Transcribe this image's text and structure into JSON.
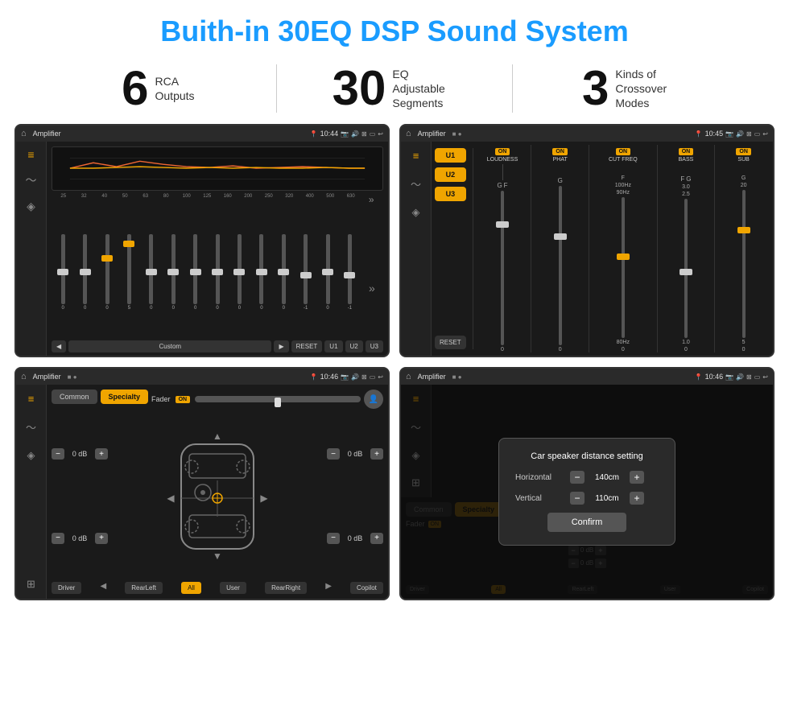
{
  "page": {
    "title": "Buith-in 30EQ DSP Sound System"
  },
  "stats": [
    {
      "number": "6",
      "label": "RCA\nOutputs"
    },
    {
      "number": "30",
      "label": "EQ Adjustable\nSegments"
    },
    {
      "number": "3",
      "label": "Kinds of\nCrossover Modes"
    }
  ],
  "screen1": {
    "status_title": "Amplifier",
    "time": "10:44",
    "eq_freqs": [
      "25",
      "32",
      "40",
      "50",
      "63",
      "80",
      "100",
      "125",
      "160",
      "200",
      "250",
      "320",
      "400",
      "500",
      "630"
    ],
    "eq_values": [
      "0",
      "0",
      "0",
      "5",
      "0",
      "0",
      "0",
      "0",
      "0",
      "0",
      "0",
      "0",
      "-1",
      "0",
      "-1"
    ],
    "eq_preset": "Custom",
    "buttons": [
      "RESET",
      "U1",
      "U2",
      "U3"
    ]
  },
  "screen2": {
    "status_title": "Amplifier",
    "time": "10:45",
    "u_buttons": [
      "U1",
      "U2",
      "U3"
    ],
    "controls": [
      {
        "label": "LOUDNESS",
        "on": true
      },
      {
        "label": "PHAT",
        "on": true
      },
      {
        "label": "CUT FREQ",
        "on": true
      },
      {
        "label": "BASS",
        "on": true
      },
      {
        "label": "SUB",
        "on": true
      }
    ],
    "reset_label": "RESET"
  },
  "screen3": {
    "status_title": "Amplifier",
    "time": "10:46",
    "tabs": [
      "Common",
      "Specialty"
    ],
    "active_tab": "Specialty",
    "fader_label": "Fader",
    "fader_on": "ON",
    "db_values": [
      "0 dB",
      "0 dB",
      "0 dB",
      "0 dB"
    ],
    "buttons": [
      "Driver",
      "RearLeft",
      "All",
      "User",
      "RearRight",
      "Copilot"
    ]
  },
  "screen4": {
    "status_title": "Amplifier",
    "time": "10:46",
    "tabs": [
      "Common",
      "Specialty"
    ],
    "dialog": {
      "title": "Car speaker distance setting",
      "horizontal_label": "Horizontal",
      "horizontal_value": "140cm",
      "vertical_label": "Vertical",
      "vertical_value": "110cm",
      "confirm_label": "Confirm"
    },
    "db_values": [
      "0 dB",
      "0 dB"
    ],
    "buttons": [
      "Driver",
      "RearLeft",
      "All",
      "User",
      "RearRight",
      "Copilot"
    ]
  },
  "colors": {
    "accent": "#f0a500",
    "title_blue": "#1a9cff",
    "bg_dark": "#1a1a1a",
    "panel_dark": "#2a2a2a"
  }
}
